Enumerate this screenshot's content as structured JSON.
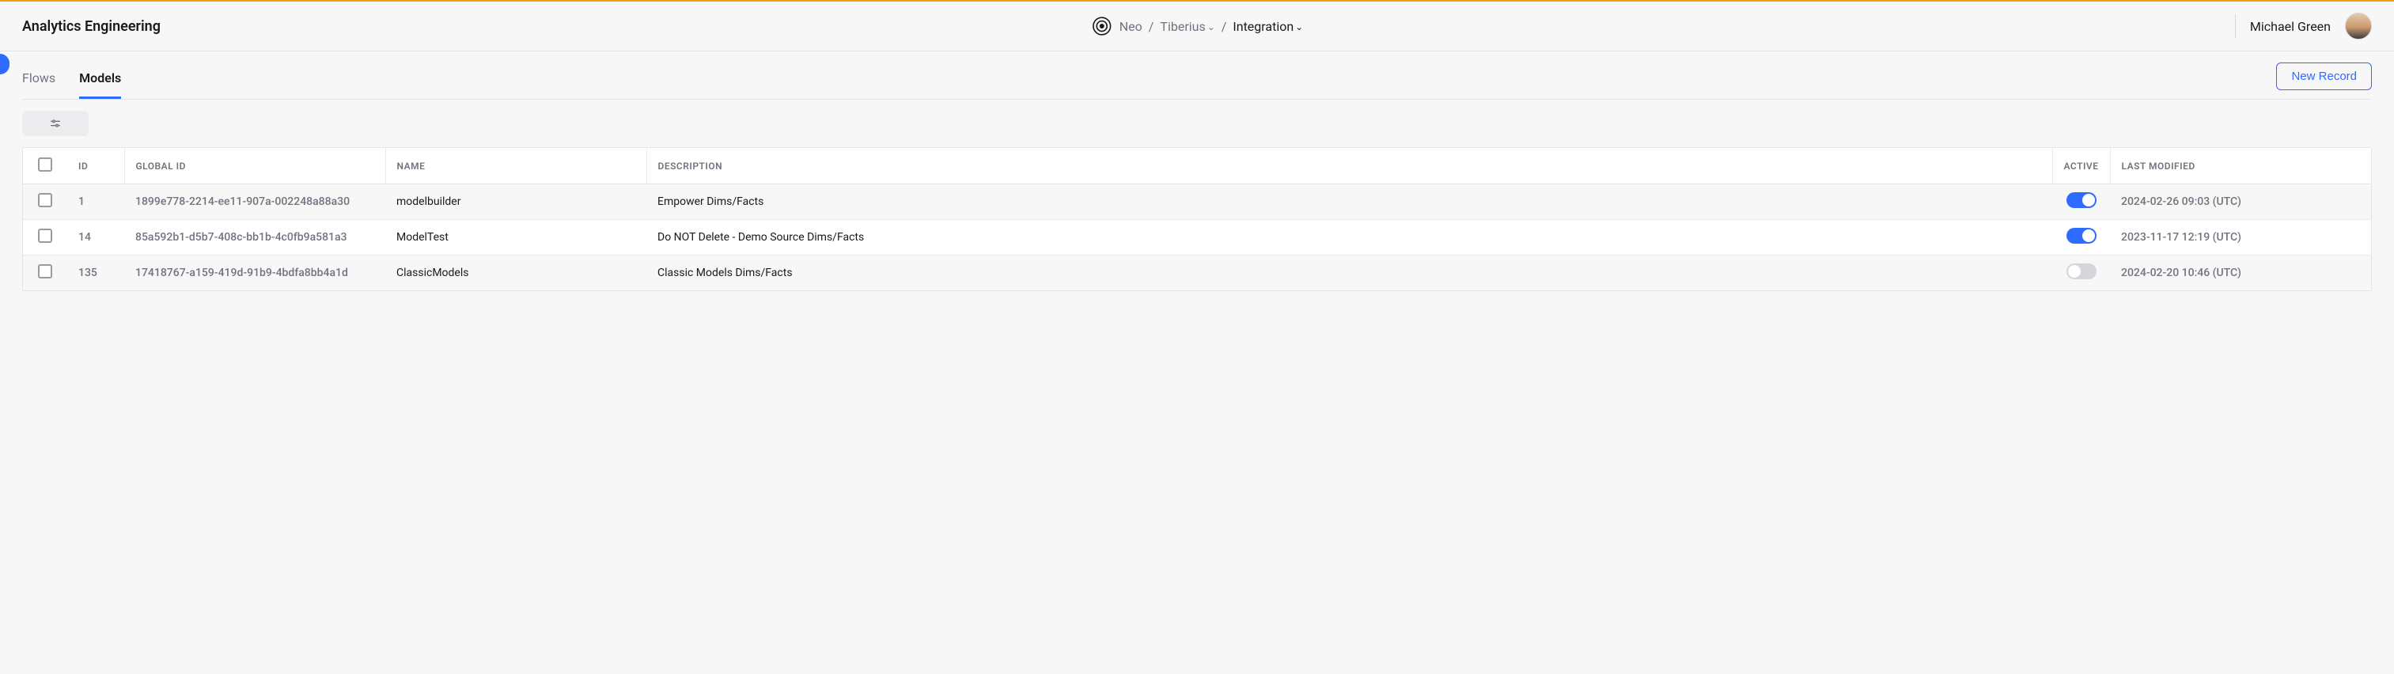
{
  "header": {
    "title": "Analytics Engineering",
    "breadcrumb": {
      "org": "Neo",
      "project": "Tiberius",
      "env": "Integration"
    },
    "user": {
      "name": "Michael Green"
    }
  },
  "tabs": {
    "items": [
      {
        "label": "Flows",
        "active": false
      },
      {
        "label": "Models",
        "active": true
      }
    ],
    "new_button": "New Record"
  },
  "table": {
    "columns": {
      "id": "ID",
      "global_id": "GLOBAL ID",
      "name": "NAME",
      "description": "DESCRIPTION",
      "active": "ACTIVE",
      "last_modified": "LAST MODIFIED"
    },
    "rows": [
      {
        "id": "1",
        "global_id": "1899e778-2214-ee11-907a-002248a88a30",
        "name": "modelbuilder",
        "description": "Empower Dims/Facts",
        "active": true,
        "last_modified": "2024-02-26 09:03 (UTC)"
      },
      {
        "id": "14",
        "global_id": "85a592b1-d5b7-408c-bb1b-4c0fb9a581a3",
        "name": "ModelTest",
        "description": "Do NOT Delete - Demo Source Dims/Facts",
        "active": true,
        "last_modified": "2023-11-17 12:19 (UTC)"
      },
      {
        "id": "135",
        "global_id": "17418767-a159-419d-91b9-4bdfa8bb4a1d",
        "name": "ClassicModels",
        "description": "Classic Models Dims/Facts",
        "active": false,
        "last_modified": "2024-02-20 10:46 (UTC)"
      }
    ]
  }
}
